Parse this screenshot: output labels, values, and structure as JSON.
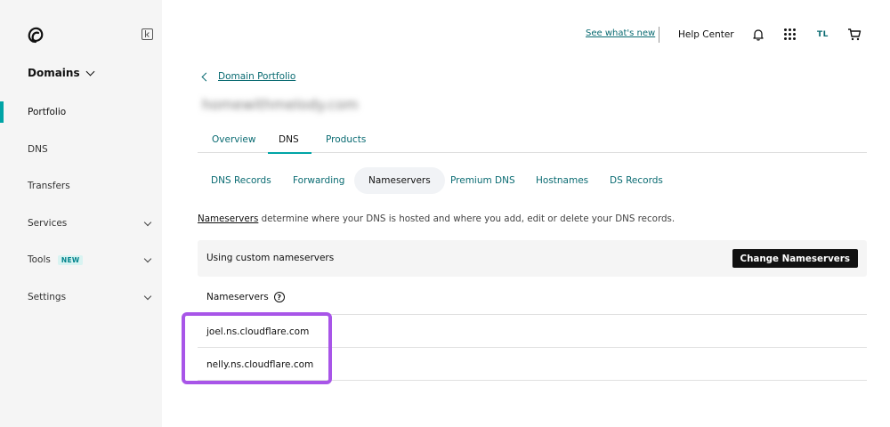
{
  "sidebar": {
    "section_title": "Domains",
    "items": [
      {
        "label": "Portfolio",
        "active": true
      },
      {
        "label": "DNS"
      },
      {
        "label": "Transfers"
      },
      {
        "label": "Services",
        "expandable": true
      },
      {
        "label": "Tools",
        "badge": "NEW",
        "expandable": true
      },
      {
        "label": "Settings",
        "expandable": true
      }
    ]
  },
  "topbar": {
    "whats_new": "See what's new",
    "help_center": "Help Center",
    "avatar_initials": "TL"
  },
  "breadcrumb": {
    "label": "Domain Portfolio"
  },
  "domain": {
    "name": "homewithmelody.com"
  },
  "main_tabs": [
    "Overview",
    "DNS",
    "Products"
  ],
  "sub_tabs": [
    "DNS Records",
    "Forwarding",
    "Nameservers",
    "Premium DNS",
    "Hostnames",
    "DS Records"
  ],
  "description": {
    "link": "Nameservers",
    "text": " determine where your DNS is hosted and where you add, edit or delete your DNS records."
  },
  "nameserver_panel": {
    "status": "Using custom nameservers",
    "change_button": "Change Nameservers",
    "header": "Nameservers",
    "help": "?",
    "entries": [
      "joel.ns.cloudflare.com",
      "nelly.ns.cloudflare.com"
    ]
  },
  "colors": {
    "accent": "#00a4a6",
    "link": "#0a6b72",
    "highlight": "#a855e8"
  }
}
